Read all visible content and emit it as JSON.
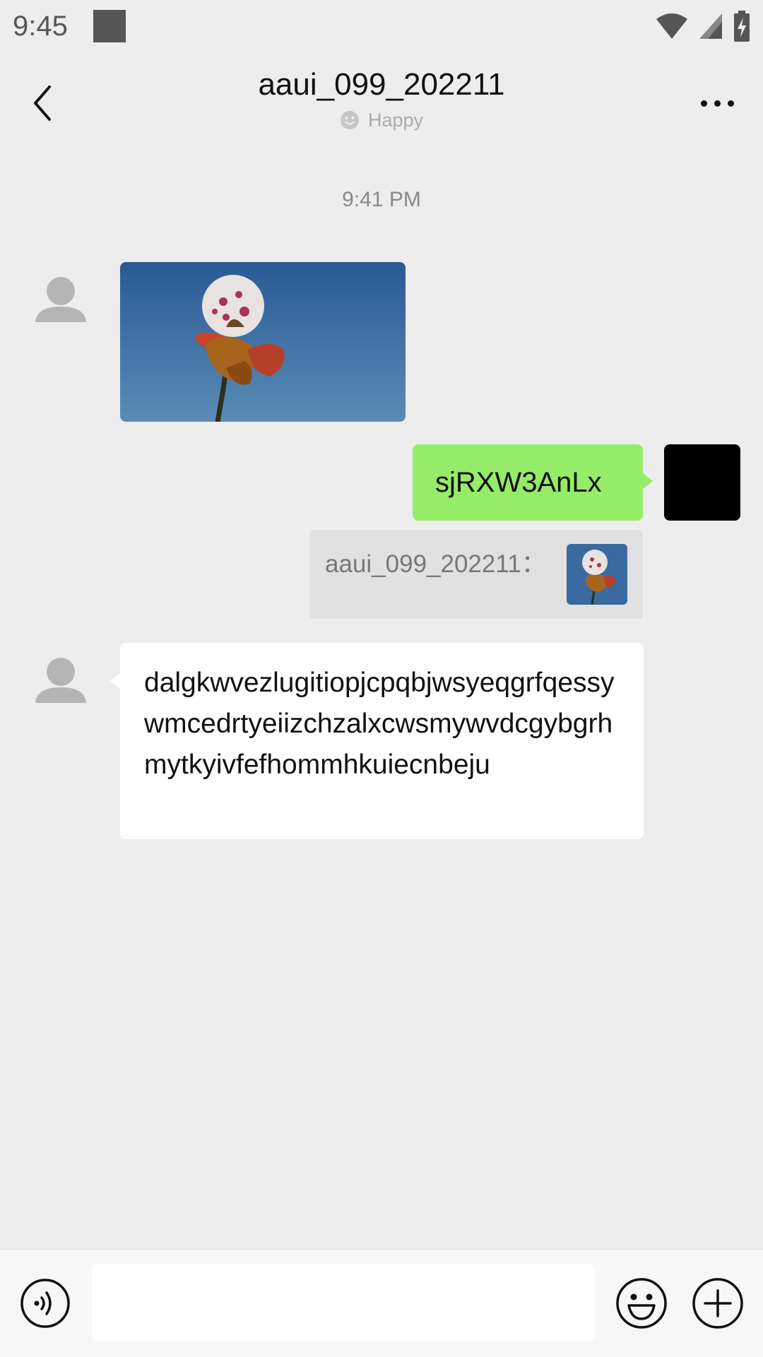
{
  "status_bar": {
    "time": "9:45",
    "icons": [
      "notification-square-icon",
      "wifi-icon",
      "signal-icon",
      "battery-charging-icon"
    ]
  },
  "header": {
    "title": "aaui_099_202211",
    "status": "Happy",
    "status_icon": "smiley-icon"
  },
  "chat": {
    "timestamp": "9:41 PM",
    "messages": [
      {
        "type": "image",
        "direction": "received",
        "content": "flower-photo"
      },
      {
        "type": "text",
        "direction": "sent",
        "text": "sjRXW3AnLx",
        "quote": {
          "author": "aaui_099_202211：",
          "thumbnail": "flower-photo"
        }
      },
      {
        "type": "text",
        "direction": "received",
        "text": "dalgkwvezlugitiopjcpqbjwsyeqgrfqessywmcedrtyeiizchzalxcwsmywvdcgybgrhmytkyivfefhommhkuiecnbeju"
      }
    ]
  },
  "input_bar": {
    "placeholder": "",
    "icons": [
      "voice-icon",
      "emoji-icon",
      "plus-icon"
    ]
  },
  "colors": {
    "background": "#ededed",
    "sent_bubble": "#95ec69",
    "received_bubble": "#ffffff"
  }
}
